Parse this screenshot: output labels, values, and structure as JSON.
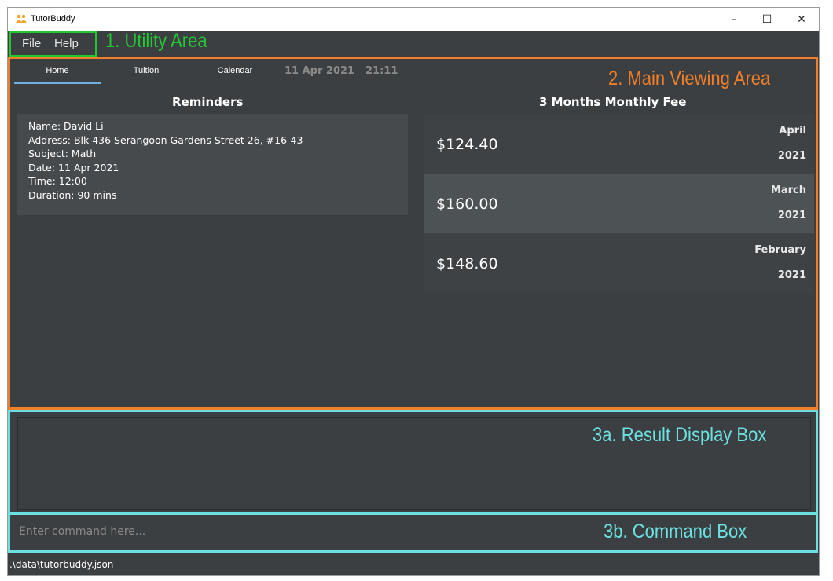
{
  "window": {
    "title": "TutorBuddy",
    "controls": {
      "minimize": "–",
      "maximize": "☐",
      "close": "✕"
    }
  },
  "menu": {
    "file": "File",
    "help": "Help"
  },
  "tabs": [
    {
      "label": "Home",
      "selected": true
    },
    {
      "label": "Tuition",
      "selected": false
    },
    {
      "label": "Calendar",
      "selected": false
    }
  ],
  "clock": {
    "date": "11 Apr 2021",
    "time": "21:11"
  },
  "reminders": {
    "title": "Reminders",
    "items": [
      {
        "name": "Name: David Li",
        "address": "Address: Blk 436 Serangoon Gardens Street 26, #16-43",
        "subject": "Subject: Math",
        "date": "Date: 11 Apr 2021",
        "time": "Time: 12:00",
        "duration": "Duration: 90 mins"
      }
    ]
  },
  "fees": {
    "title": "3 Months Monthly Fee",
    "items": [
      {
        "amount": "$124.40",
        "month": "April",
        "year": "2021"
      },
      {
        "amount": "$160.00",
        "month": "March",
        "year": "2021"
      },
      {
        "amount": "$148.60",
        "month": "February",
        "year": "2021"
      }
    ]
  },
  "command": {
    "placeholder": "Enter command here..."
  },
  "status": {
    "path": ".\\data\\tutorbuddy.json"
  },
  "annotations": {
    "utility": "1. Utility Area",
    "main": "2. Main Viewing Area",
    "result": "3a. Result Display Box",
    "command": "3b. Command Box"
  },
  "colors": {
    "background": "#3c3f41",
    "selected_tab_underline": "#6fb0e0",
    "utility_annotation": "#22c832",
    "main_annotation": "#f07f2a",
    "command_annotation": "#6be0e0"
  },
  "icons": {
    "app": "people-group-icon"
  }
}
